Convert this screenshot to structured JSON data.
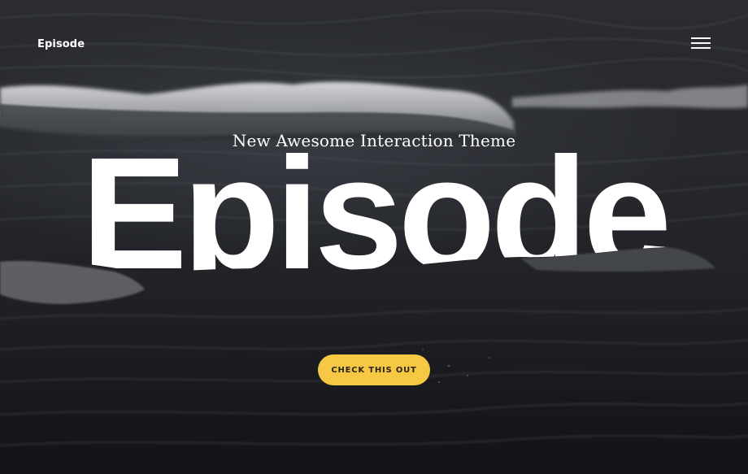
{
  "header": {
    "brand": "Episode",
    "menu_icon": "hamburger-menu-icon"
  },
  "hero": {
    "tagline": "New Awesome Interaction Theme",
    "headline": "Episode",
    "cta_label": "CHECK THIS OUT"
  },
  "colors": {
    "accent": "#f6c844",
    "text": "#ffffff",
    "background": "#1d1f24"
  }
}
